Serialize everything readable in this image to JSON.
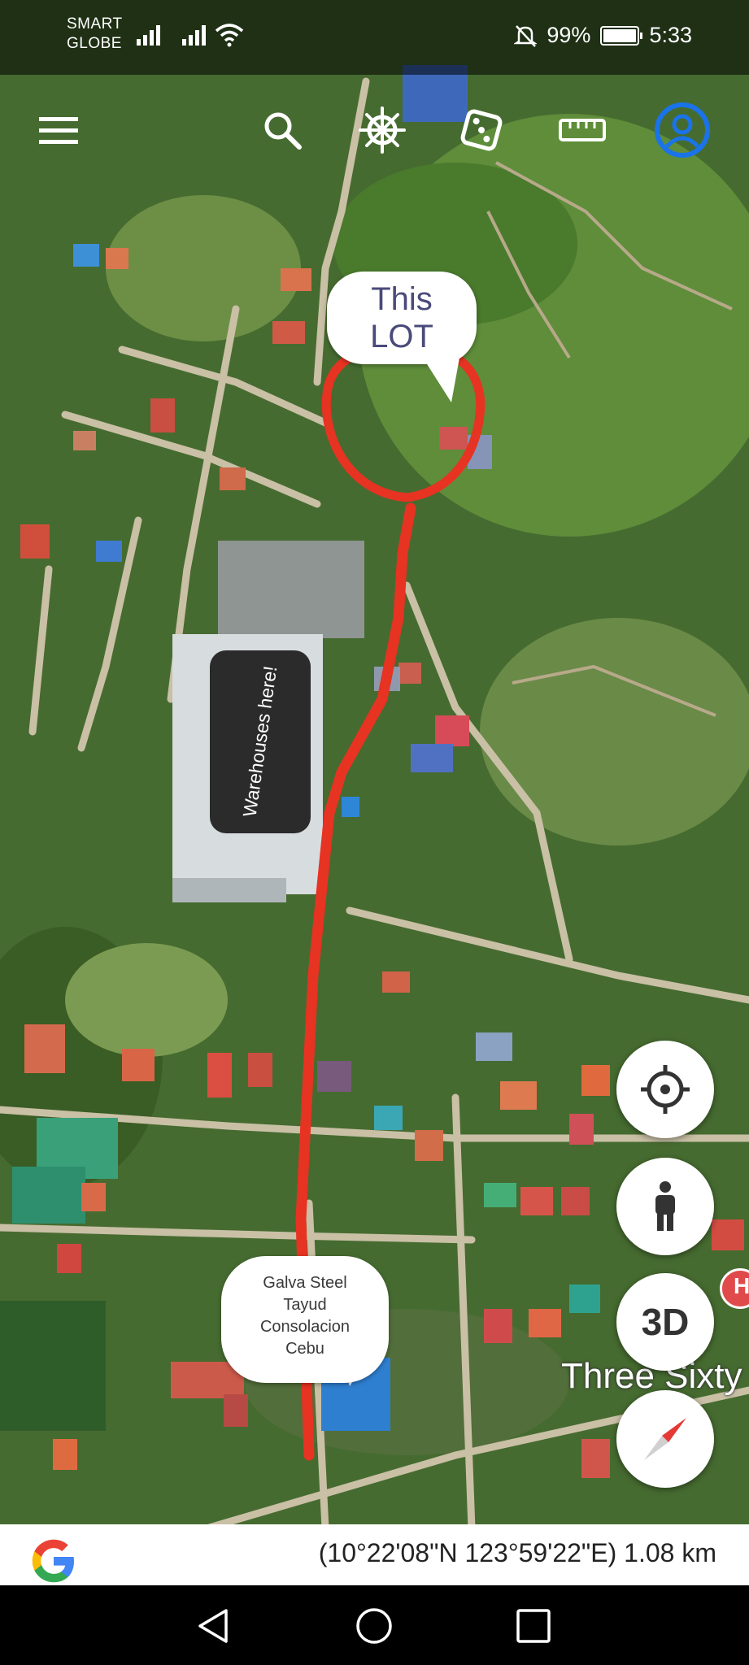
{
  "status_bar": {
    "carrier_line1": "SMART",
    "carrier_line2": "GLOBE",
    "battery_percent": "99%",
    "time": "5:33",
    "battery_level": 0.99
  },
  "toolbar": {
    "icons": [
      "menu-icon",
      "search-icon",
      "ship-wheel-icon",
      "dice-icon",
      "ruler-icon",
      "profile-icon"
    ],
    "accent_color": "#1a73e8"
  },
  "annotations": {
    "lot_label": "This LOT",
    "warehouse_label": "Warehouses here!",
    "galva_line1": "Galva Steel",
    "galva_line2": "Tayud",
    "galva_line3": "Consolacion",
    "galva_line4": "Cebu",
    "route_color": "#e63322"
  },
  "map": {
    "place_label": "Three Sixty",
    "buttons": {
      "locate_icon": "crosshair-icon",
      "streetview_icon": "pegman-icon",
      "three_d": "3D",
      "compass_icon": "compass-icon"
    }
  },
  "coordinate_bar": {
    "coords": "(10°22'08\"N 123°59'22\"E) 1.08 km",
    "logo": "G"
  },
  "nav_bar": {
    "icons": [
      "back-icon",
      "home-icon",
      "recents-icon"
    ]
  }
}
